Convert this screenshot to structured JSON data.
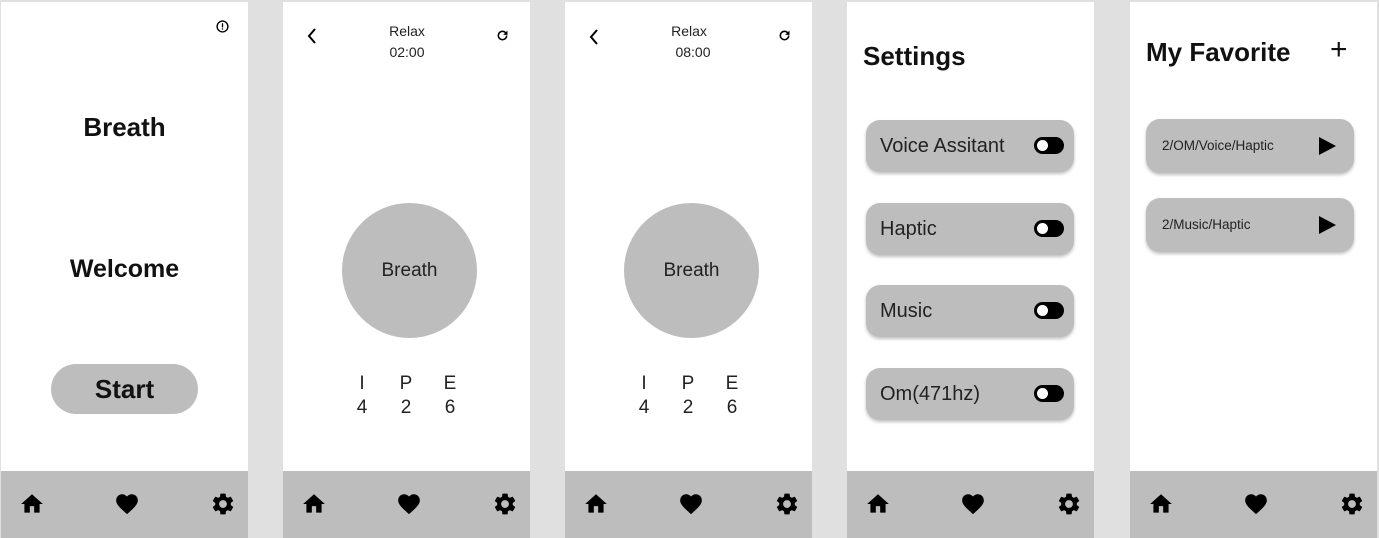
{
  "nav": {
    "home_icon": "home-icon",
    "favorite_icon": "heart-icon",
    "settings_icon": "gear-icon"
  },
  "welcome_screen": {
    "info_icon": "info-icon",
    "title": "Breath",
    "subtitle": "Welcome",
    "start_label": "Start"
  },
  "session_screen_1": {
    "back_icon": "chevron-left-icon",
    "mode": "Relax",
    "timer": "02:00",
    "refresh_icon": "refresh-icon",
    "circle_label": "Breath",
    "phases": [
      {
        "letter": "I",
        "value": "4"
      },
      {
        "letter": "P",
        "value": "2"
      },
      {
        "letter": "E",
        "value": "6"
      }
    ]
  },
  "session_screen_2": {
    "back_icon": "chevron-left-icon",
    "mode": "Relax",
    "timer": "08:00",
    "refresh_icon": "refresh-icon",
    "circle_label": "Breath",
    "phases": [
      {
        "letter": "I",
        "value": "4"
      },
      {
        "letter": "P",
        "value": "2"
      },
      {
        "letter": "E",
        "value": "6"
      }
    ]
  },
  "settings_screen": {
    "title": "Settings",
    "items": [
      {
        "label": "Voice Assitant",
        "enabled": false
      },
      {
        "label": "Haptic",
        "enabled": false
      },
      {
        "label": "Music",
        "enabled": false
      },
      {
        "label": "Om(471hz)",
        "enabled": false
      }
    ]
  },
  "favorites_screen": {
    "title": "My Favorite",
    "add_label": "+",
    "items": [
      {
        "label": "2/OM/Voice/Haptic"
      },
      {
        "label": "2/Music/Haptic"
      }
    ]
  }
}
